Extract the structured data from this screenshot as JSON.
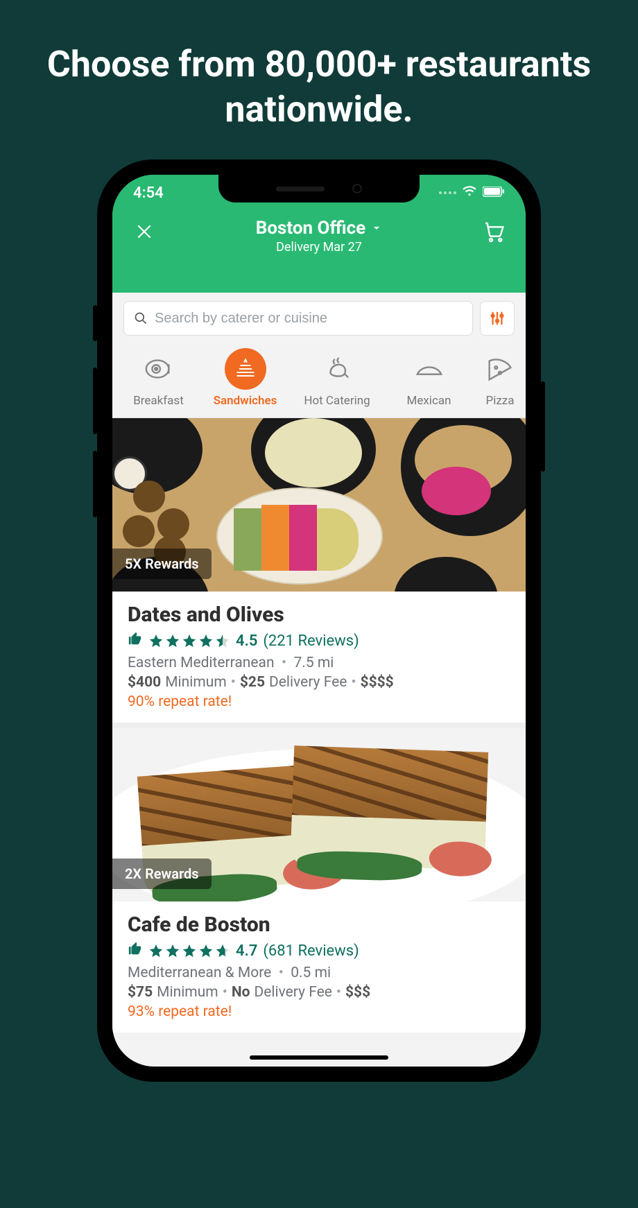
{
  "marketing_headline": "Choose from 80,000+ restaurants nationwide.",
  "status": {
    "time": "4:54"
  },
  "header": {
    "location": "Boston Office",
    "delivery_line": "Delivery Mar 27"
  },
  "search": {
    "placeholder": "Search by caterer or cuisine"
  },
  "categories": [
    {
      "id": "breakfast",
      "label": "Breakfast",
      "active": false
    },
    {
      "id": "sandwiches",
      "label": "Sandwiches",
      "active": true
    },
    {
      "id": "hot-catering",
      "label": "Hot Catering",
      "active": false
    },
    {
      "id": "mexican",
      "label": "Mexican",
      "active": false
    },
    {
      "id": "pizza",
      "label": "Pizza",
      "active": false
    }
  ],
  "restaurants": [
    {
      "badge": "5X Rewards",
      "name": "Dates and Olives",
      "rating": "4.5",
      "reviews_label": "(221 Reviews)",
      "cuisine": "Eastern Mediterranean",
      "distance": "7.5 mi",
      "minimum_amount": "$400",
      "minimum_word": "Minimum",
      "delivery_amount": "$25",
      "delivery_word": "Delivery Fee",
      "price_level": "$$$$",
      "repeat": "90% repeat rate!"
    },
    {
      "badge": "2X Rewards",
      "name": "Cafe de Boston",
      "rating": "4.7",
      "reviews_label": "(681 Reviews)",
      "cuisine": "Mediterranean & More",
      "distance": "0.5 mi",
      "minimum_amount": "$75",
      "minimum_word": "Minimum",
      "delivery_amount": "No",
      "delivery_word": "Delivery Fee",
      "price_level": "$$$",
      "repeat": "93% repeat rate!"
    }
  ]
}
